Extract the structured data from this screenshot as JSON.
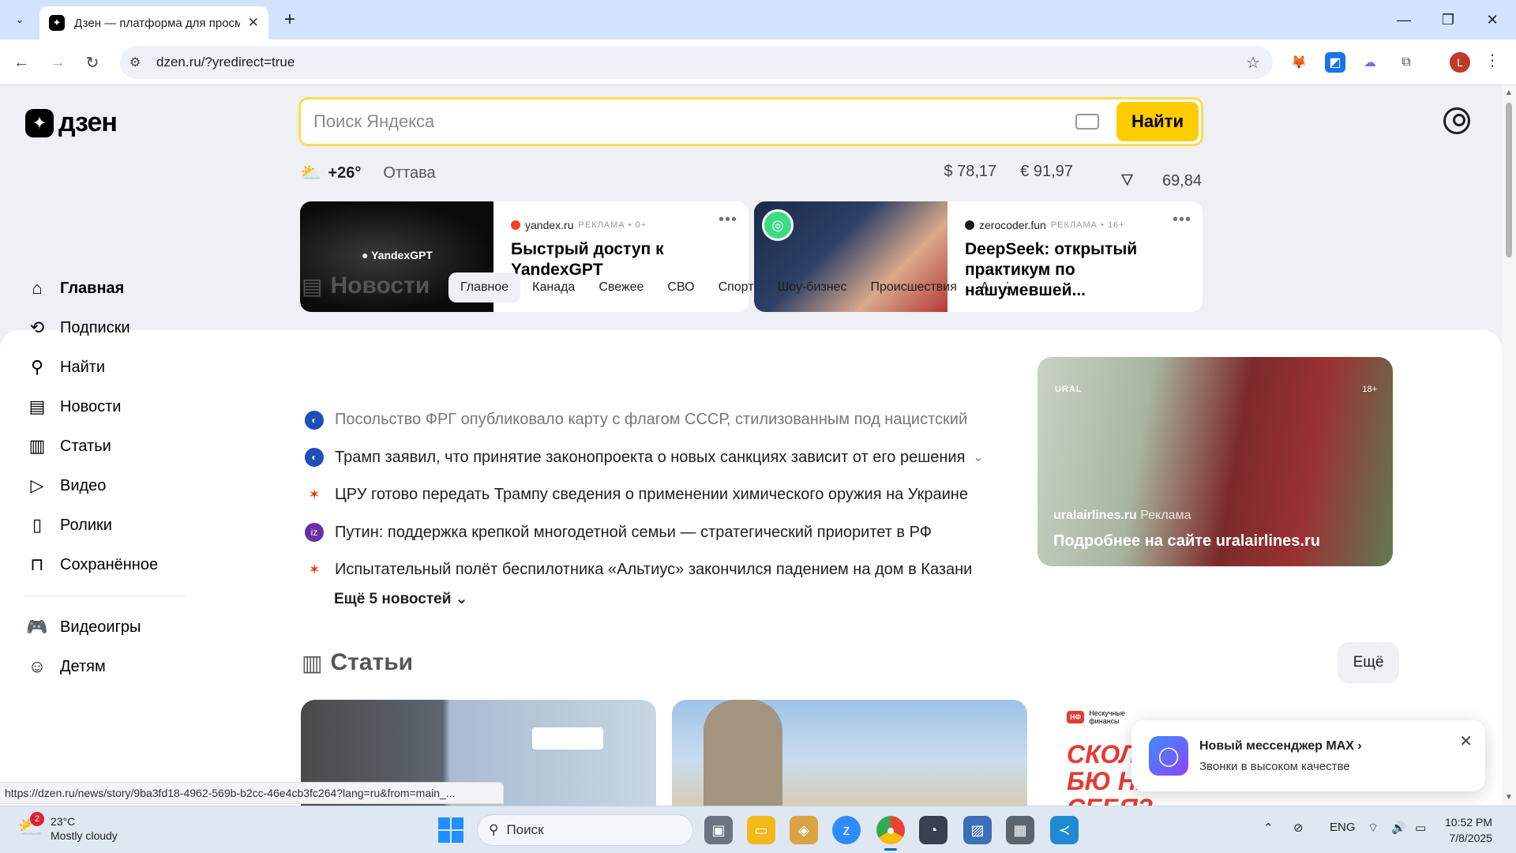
{
  "browser": {
    "tab_title": "Дзен — платформа для просмотра",
    "url": "dzen.ru/?yredirect=true",
    "profile_initial": "L"
  },
  "header": {
    "logo_text": "дзен",
    "search_placeholder": "Поиск Яндекса",
    "search_button": "Найти"
  },
  "info_bar": {
    "temperature": "+26°",
    "city": "Оттава",
    "usd": "$ 78,17",
    "eur": "€ 91,97",
    "oil": "69,84"
  },
  "ads": [
    {
      "image_label": "YandexGPT",
      "source": "yandex.ru",
      "ad_label": "РЕКЛАМА • 0+",
      "headline": "Быстрый доступ к YandexGPT"
    },
    {
      "source": "zerocoder.fun",
      "ad_label": "РЕКЛАМА • 16+",
      "headline": "DeepSeek: открытый практикум по нашумевшей..."
    }
  ],
  "sidebar": {
    "items": [
      {
        "label": "Главная",
        "icon": "home-icon"
      },
      {
        "label": "Подписки",
        "icon": "subscriptions-icon"
      },
      {
        "label": "Найти",
        "icon": "search-icon"
      },
      {
        "label": "Новости",
        "icon": "news-icon"
      },
      {
        "label": "Статьи",
        "icon": "articles-icon"
      },
      {
        "label": "Видео",
        "icon": "video-icon"
      },
      {
        "label": "Ролики",
        "icon": "shorts-icon"
      },
      {
        "label": "Сохранённое",
        "icon": "bookmark-icon"
      },
      {
        "label": "Видеоигры",
        "icon": "gamepad-icon"
      },
      {
        "label": "Детям",
        "icon": "kids-icon"
      }
    ]
  },
  "news": {
    "title": "Новости",
    "tabs": [
      "Главное",
      "Канада",
      "Свежее",
      "СВО",
      "Спорт",
      "Шоу-бизнес",
      "Происшествия",
      "А"
    ],
    "items": [
      "Посольство ФРГ опубликовало карту с флагом СССР, стилизованным под нацистский",
      "Трамп заявил, что принятие законопроекта о новых санкциях зависит от его решения",
      "ЦРУ готово передать Трампу сведения о применении химического оружия на Украине",
      "Путин: поддержка крепкой многодетной семьи — стратегический приоритет в РФ",
      "Испытательный полёт беспилотника «Альтиус» закончился падением на дом в Казани"
    ],
    "more": "Ещё 5 новостей"
  },
  "promo": {
    "brand": "URAL",
    "age": "18+",
    "source": "uralairlines.ru",
    "ad_label": "Реклама",
    "cta": "Подробнее на сайте uralairlines.ru"
  },
  "articles": {
    "title": "Статьи",
    "more": "Ещё",
    "third_card_text": "СКОЛ ИЗ БЮ НА СЕБЯ?",
    "third_card_brand": "Нескучные финансы"
  },
  "toast": {
    "title": "Новый мессенджер MAX",
    "subtitle": "Звонки в высоком качестве"
  },
  "status_url": "https://dzen.ru/news/story/9ba3fd18-4962-569b-b2cc-46e4cb3fc264?lang=ru&from=main_...",
  "taskbar": {
    "weather_temp": "23°C",
    "weather_desc": "Mostly cloudy",
    "weather_badge": "2",
    "search": "Поиск",
    "lang": "ENG",
    "time": "10:52 PM",
    "date": "7/8/2025"
  }
}
